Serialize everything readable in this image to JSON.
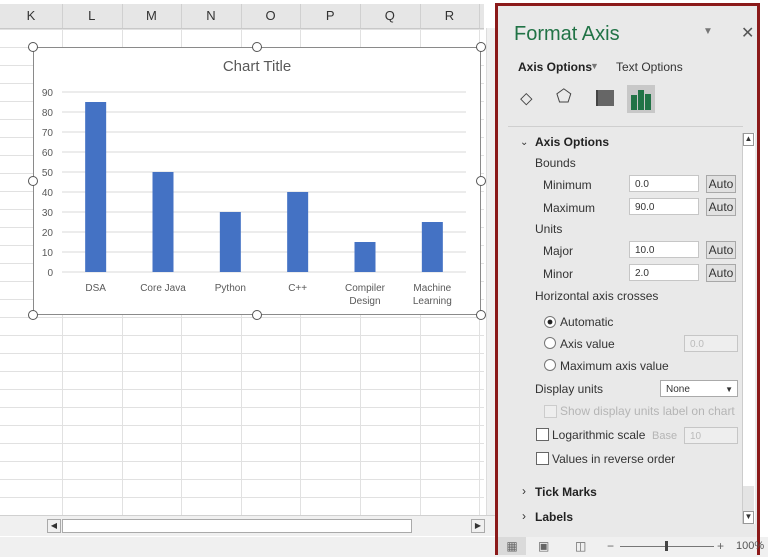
{
  "sheet": {
    "columns": [
      "K",
      "L",
      "M",
      "N",
      "O",
      "P",
      "Q",
      "R"
    ]
  },
  "chart_data": {
    "type": "bar",
    "title": "Chart Title",
    "categories": [
      "DSA",
      "Core Java",
      "Python",
      "C++",
      "Compiler Design",
      "Machine Learning"
    ],
    "category_lines": [
      [
        "DSA"
      ],
      [
        "Core Java"
      ],
      [
        "Python"
      ],
      [
        "C++"
      ],
      [
        "Compiler",
        "Design"
      ],
      [
        "Machine",
        "Learning"
      ]
    ],
    "values": [
      85,
      50,
      30,
      40,
      15,
      25
    ],
    "ylim": [
      0,
      90
    ],
    "yticks": [
      "0",
      "10",
      "20",
      "30",
      "40",
      "50",
      "60",
      "70",
      "80",
      "90"
    ],
    "bar_color": "#4472c4",
    "xlabel": "",
    "ylabel": "",
    "grid": true
  },
  "panel": {
    "title": "Format Axis",
    "tab_axis": "Axis Options",
    "tab_text": "Text Options",
    "section": "Axis Options",
    "bounds": "Bounds",
    "minimum": "Minimum",
    "minimum_value": "0.0",
    "maximum": "Maximum",
    "maximum_value": "90.0",
    "units": "Units",
    "major": "Major",
    "major_value": "10.0",
    "minor": "Minor",
    "minor_value": "2.0",
    "auto": "Auto",
    "crosses": "Horizontal axis crosses",
    "automatic": "Automatic",
    "axis_value": "Axis value",
    "axis_value_input": "0.0",
    "max_axis": "Maximum axis value",
    "display_units": "Display units",
    "display_units_value": "None",
    "show_units_label": "Show display units label on chart",
    "log_scale": "Logarithmic scale",
    "base": "Base",
    "base_value": "10",
    "reverse": "Values in reverse order",
    "tick_marks": "Tick Marks",
    "labels": "Labels"
  },
  "status": {
    "zoom": "100%"
  },
  "colors": {
    "accent": "#217346",
    "border": "#8b1a1a"
  }
}
